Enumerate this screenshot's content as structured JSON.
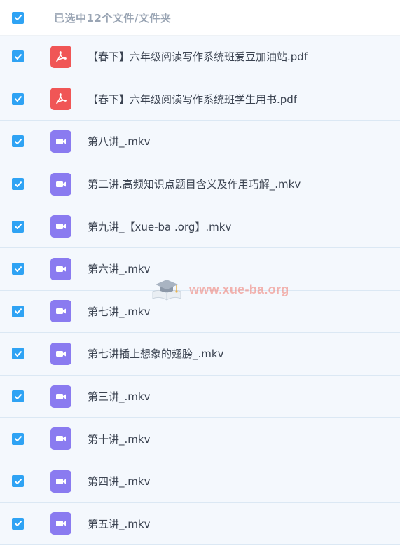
{
  "header": {
    "selection_text": "已选中12个文件/文件夹"
  },
  "files": [
    {
      "name": "【春下】六年级阅读写作系统班爱豆加油站.pdf",
      "type": "pdf"
    },
    {
      "name": "【春下】六年级阅读写作系统班学生用书.pdf",
      "type": "pdf"
    },
    {
      "name": "第八讲_.mkv",
      "type": "video"
    },
    {
      "name": "第二讲.高频知识点题目含义及作用巧解_.mkv",
      "type": "video"
    },
    {
      "name": "第九讲_【xue-ba .org】.mkv",
      "type": "video"
    },
    {
      "name": "第六讲_.mkv",
      "type": "video"
    },
    {
      "name": "第七讲_.mkv",
      "type": "video"
    },
    {
      "name": "第七讲插上想象的翅膀_.mkv",
      "type": "video"
    },
    {
      "name": "第三讲_.mkv",
      "type": "video"
    },
    {
      "name": "第十讲_.mkv",
      "type": "video"
    },
    {
      "name": "第四讲_.mkv",
      "type": "video"
    },
    {
      "name": "第五讲_.mkv",
      "type": "video"
    }
  ],
  "watermark": {
    "text": "www.xue-ba.org",
    "icon": "graduation-cap-book-logo"
  },
  "colors": {
    "checkbox": "#2fa3f4",
    "pdf_icon": "#f05656",
    "video_icon": "#8a7bf0",
    "row_bg": "#f4f8fd"
  }
}
